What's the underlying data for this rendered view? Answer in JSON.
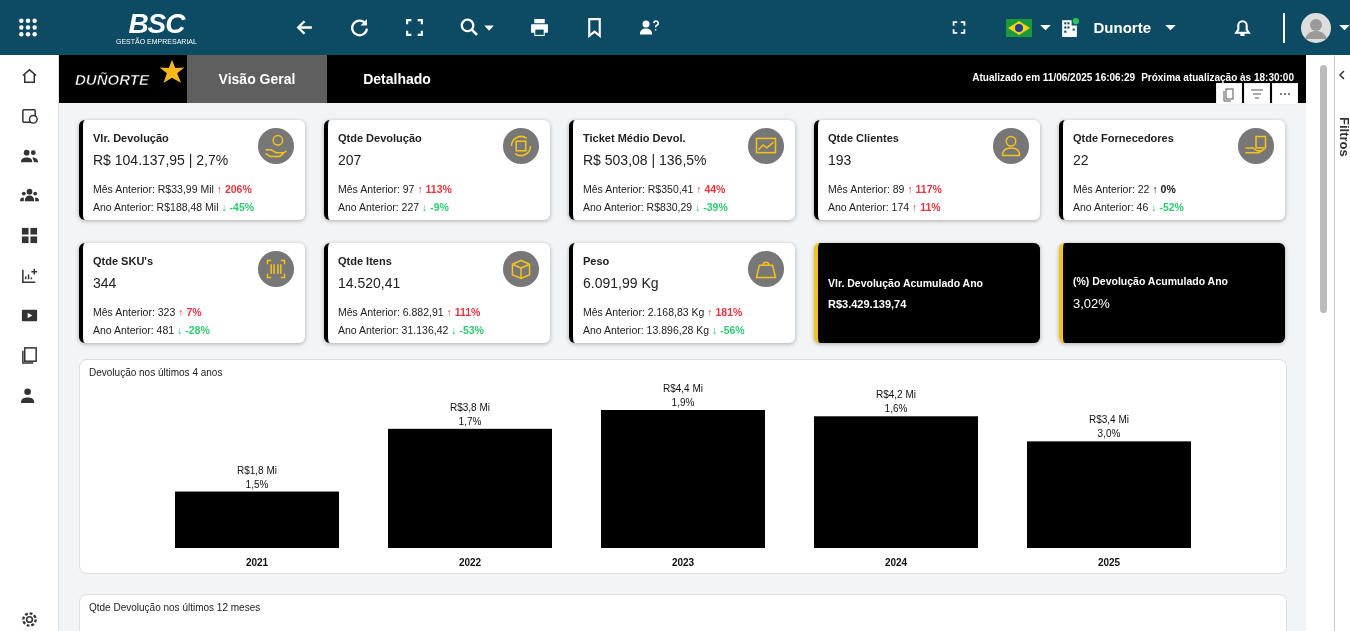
{
  "topbar": {
    "logo": {
      "mark": "BSC",
      "tagline": "GESTÃO EMPRESARIAL"
    },
    "company": "Dunorte"
  },
  "header": {
    "logo": "DUÑORTE",
    "tabs": [
      {
        "label": "Visão Geral",
        "selected": true
      },
      {
        "label": "Detalhado",
        "selected": false
      }
    ],
    "updated": "Atualizado em 11/06/2025 16:06:29",
    "next_update": "Próxima atualização às 18:30:00"
  },
  "cards": [
    {
      "kind": "metric",
      "title": "Vlr. Devolução",
      "value": "R$ 104.137,95 | 2,7%",
      "rows": [
        {
          "label": "Mês Anterior: R$33,99 Mil",
          "arrow": "↑",
          "change": "206%",
          "color": "#e8343f"
        },
        {
          "label": "Ano Anterior: R$188,48 Mil",
          "arrow": "↓",
          "change": "-45%",
          "color": "#2ecc71"
        }
      ]
    },
    {
      "kind": "metric",
      "title": "Qtde Devolução",
      "value": "207",
      "rows": [
        {
          "label": "Mês Anterior: 97",
          "arrow": "↑",
          "change": "113%",
          "color": "#e8343f"
        },
        {
          "label": "Ano Anterior: 227",
          "arrow": "↓",
          "change": "-9%",
          "color": "#2ecc71"
        }
      ]
    },
    {
      "kind": "metric",
      "title": "Ticket Médio Devol.",
      "value": "R$ 503,08 | 136,5%",
      "rows": [
        {
          "label": "Mês Anterior: R$350,41",
          "arrow": "↑",
          "change": "44%",
          "color": "#e8343f"
        },
        {
          "label": "Ano Anterior: R$830,29",
          "arrow": "↓",
          "change": "-39%",
          "color": "#2ecc71"
        }
      ]
    },
    {
      "kind": "metric",
      "title": "Qtde Clientes",
      "value": "193",
      "rows": [
        {
          "label": "Mês Anterior: 89",
          "arrow": "↑",
          "change": "117%",
          "color": "#e8343f"
        },
        {
          "label": "Ano Anterior: 174",
          "arrow": "↑",
          "change": "11%",
          "color": "#e8343f"
        }
      ]
    },
    {
      "kind": "metric",
      "title": "Qtde Fornecedores",
      "value": "22",
      "rows": [
        {
          "label": "Mês Anterior: 22",
          "arrow": "↑",
          "change": "0%",
          "color": "#222222"
        },
        {
          "label": "Ano Anterior: 46",
          "arrow": "↓",
          "change": "-52%",
          "color": "#2ecc71"
        }
      ]
    },
    {
      "kind": "metric",
      "title": "Qtde SKU's",
      "value": "344",
      "rows": [
        {
          "label": "Mês Anterior: 323",
          "arrow": "↑",
          "change": "7%",
          "color": "#e8343f"
        },
        {
          "label": "Ano Anterior: 481",
          "arrow": "↓",
          "change": "-28%",
          "color": "#2ecc71"
        }
      ]
    },
    {
      "kind": "metric",
      "title": "Qtde Itens",
      "value": "14.520,41",
      "rows": [
        {
          "label": "Mês Anterior: 6.882,91",
          "arrow": "↑",
          "change": "111%",
          "color": "#e8343f"
        },
        {
          "label": "Ano Anterior: 31.136,42",
          "arrow": "↓",
          "change": "-53%",
          "color": "#2ecc71"
        }
      ]
    },
    {
      "kind": "metric",
      "title": "Peso",
      "value": "6.091,99 Kg",
      "rows": [
        {
          "label": "Mês Anterior: 2.168,83 Kg",
          "arrow": "↑",
          "change": "181%",
          "color": "#e8343f"
        },
        {
          "label": "Ano Anterior: 13.896,28 Kg",
          "arrow": "↓",
          "change": "-56%",
          "color": "#2ecc71"
        }
      ]
    },
    {
      "kind": "highlight",
      "title": "Vlr. Devolução Acumulado Ano",
      "value": "R$3.429.139,74"
    },
    {
      "kind": "highlight",
      "title": "(%) Devolução Acumulado Ano",
      "value": "3,02%"
    }
  ],
  "chart_panel": {
    "title": "Devolução nos últimos 4 anos",
    "chart_data": {
      "type": "bar",
      "categories": [
        "2021",
        "2022",
        "2023",
        "2024",
        "2025"
      ],
      "values": [
        1.8,
        3.8,
        4.4,
        4.2,
        3.4
      ],
      "data_labels": true,
      "value_labels": [
        "R$1,8 Mi",
        "R$3,8 Mi",
        "R$4,4 Mi",
        "R$4,2 Mi",
        "R$3,4 Mi"
      ],
      "annotations": [
        "1,5%",
        "1,7%",
        "1,9%",
        "1,6%",
        "3,0%"
      ]
    }
  },
  "second_panel": {
    "title": "Qtde Devolução nos últimos 12 meses"
  },
  "filter_panel": {
    "label": "Filtros"
  }
}
